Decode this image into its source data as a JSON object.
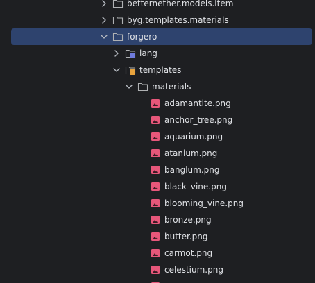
{
  "tree": {
    "nodes": [
      {
        "label": "betternether.models.item",
        "type": "folder",
        "state": "collapsed",
        "icon": "folder-icon",
        "level": 1
      },
      {
        "label": "byg.templates.materials",
        "type": "folder",
        "state": "collapsed",
        "icon": "folder-icon",
        "level": 1
      },
      {
        "label": "forgero",
        "type": "folder",
        "state": "expanded",
        "icon": "folder-icon",
        "level": 1,
        "selected": true
      },
      {
        "label": "lang",
        "type": "folder",
        "state": "collapsed",
        "icon": "lang-folder-icon",
        "level": 2
      },
      {
        "label": "templates",
        "type": "folder",
        "state": "expanded",
        "icon": "templates-folder-icon",
        "level": 2
      },
      {
        "label": "materials",
        "type": "folder",
        "state": "expanded",
        "icon": "folder-icon",
        "level": 3
      },
      {
        "label": "adamantite.png",
        "type": "file",
        "icon": "image-file-icon",
        "level": 4
      },
      {
        "label": "anchor_tree.png",
        "type": "file",
        "icon": "image-file-icon",
        "level": 4
      },
      {
        "label": "aquarium.png",
        "type": "file",
        "icon": "image-file-icon",
        "level": 4
      },
      {
        "label": "atanium.png",
        "type": "file",
        "icon": "image-file-icon",
        "level": 4
      },
      {
        "label": "banglum.png",
        "type": "file",
        "icon": "image-file-icon",
        "level": 4
      },
      {
        "label": "black_vine.png",
        "type": "file",
        "icon": "image-file-icon",
        "level": 4
      },
      {
        "label": "blooming_vine.png",
        "type": "file",
        "icon": "image-file-icon",
        "level": 4
      },
      {
        "label": "bronze.png",
        "type": "file",
        "icon": "image-file-icon",
        "level": 4
      },
      {
        "label": "butter.png",
        "type": "file",
        "icon": "image-file-icon",
        "level": 4
      },
      {
        "label": "carmot.png",
        "type": "file",
        "icon": "image-file-icon",
        "level": 4
      },
      {
        "label": "celestium.png",
        "type": "file",
        "icon": "image-file-icon",
        "level": 4
      },
      {
        "label": "",
        "type": "file",
        "icon": "image-file-icon",
        "level": 4
      }
    ]
  },
  "colors": {
    "background": "#1e1f22",
    "selection": "#2e436e",
    "text": "#dfe1e5",
    "chevron": "#b4b8bf",
    "folder_stroke": "#afb1b3",
    "image_icon": "#e6577a",
    "lang_badge": "#6f7bdc",
    "templates_badge": "#e8a33d"
  }
}
